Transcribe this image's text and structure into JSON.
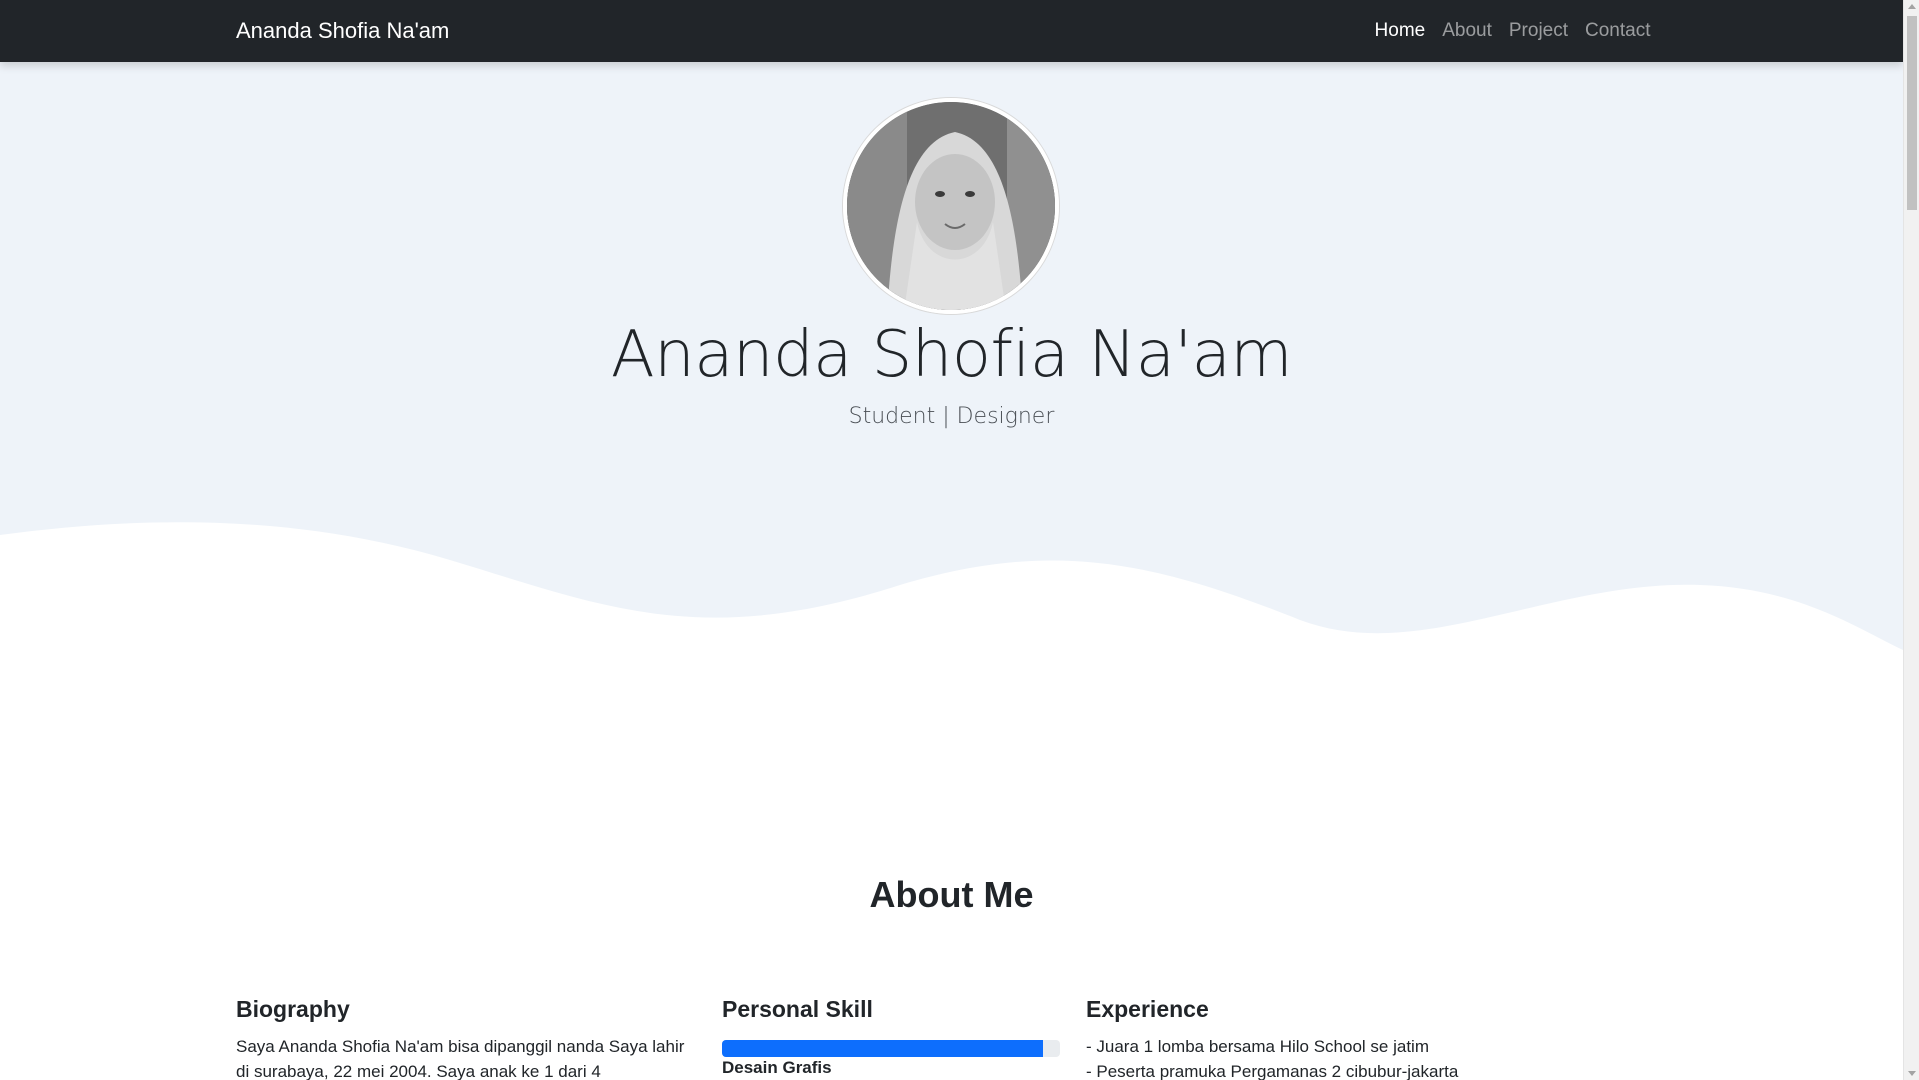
{
  "navbar": {
    "brand": "Ananda Shofia Na'am",
    "links": [
      {
        "label": "Home",
        "active": true
      },
      {
        "label": "About",
        "active": false
      },
      {
        "label": "Project",
        "active": false
      },
      {
        "label": "Contact",
        "active": false
      }
    ]
  },
  "hero": {
    "name": "Ananda Shofia Na'am",
    "subtitle": "Student | Designer",
    "background_color": "#eef3f9"
  },
  "about": {
    "title": "About Me",
    "biography": {
      "title": "Biography",
      "lines": [
        "Saya Ananda Shofia Na'am bisa dipanggil nanda Saya lahir",
        "di surabaya, 22 mei 2004. Saya anak ke 1 dari 4"
      ]
    },
    "skills": {
      "title": "Personal Skill",
      "items": [
        {
          "label": "Desain Grafis",
          "percent": 95
        }
      ],
      "bar_color": "#0d6efd"
    },
    "experience": {
      "title": "Experience",
      "lines": [
        "- Juara 1 lomba bersama Hilo School se jatim",
        "- Peserta pramuka Pergamanas 2 cibubur-jakarta"
      ]
    }
  }
}
